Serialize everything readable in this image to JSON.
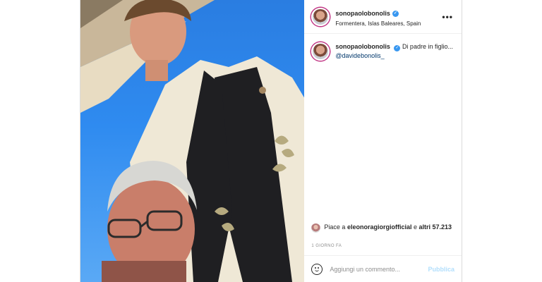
{
  "post": {
    "username": "sonopaolobonolis",
    "location": "Formentera, Islas Baleares, Spain",
    "more_label": "•••",
    "caption": {
      "username": "sonopaolobonolis",
      "text": "Di padre in figlio...",
      "mention": "@davidebonolis_"
    },
    "likes": {
      "prefix": "Piace a",
      "liker": "eleonoragiorgiofficial",
      "middle": "e",
      "others": "altri 57.213"
    },
    "time": "1 GIORNO FA",
    "comment": {
      "placeholder": "Aggiungi un commento...",
      "publish_label": "Pubblica"
    }
  },
  "icons": [
    "verified-badge-icon",
    "more-options-icon",
    "emoji-icon"
  ],
  "colors": {
    "link": "#00376b",
    "verified": "#3897f0",
    "publish": "#b2dffc",
    "muted": "#8e8e8e"
  }
}
